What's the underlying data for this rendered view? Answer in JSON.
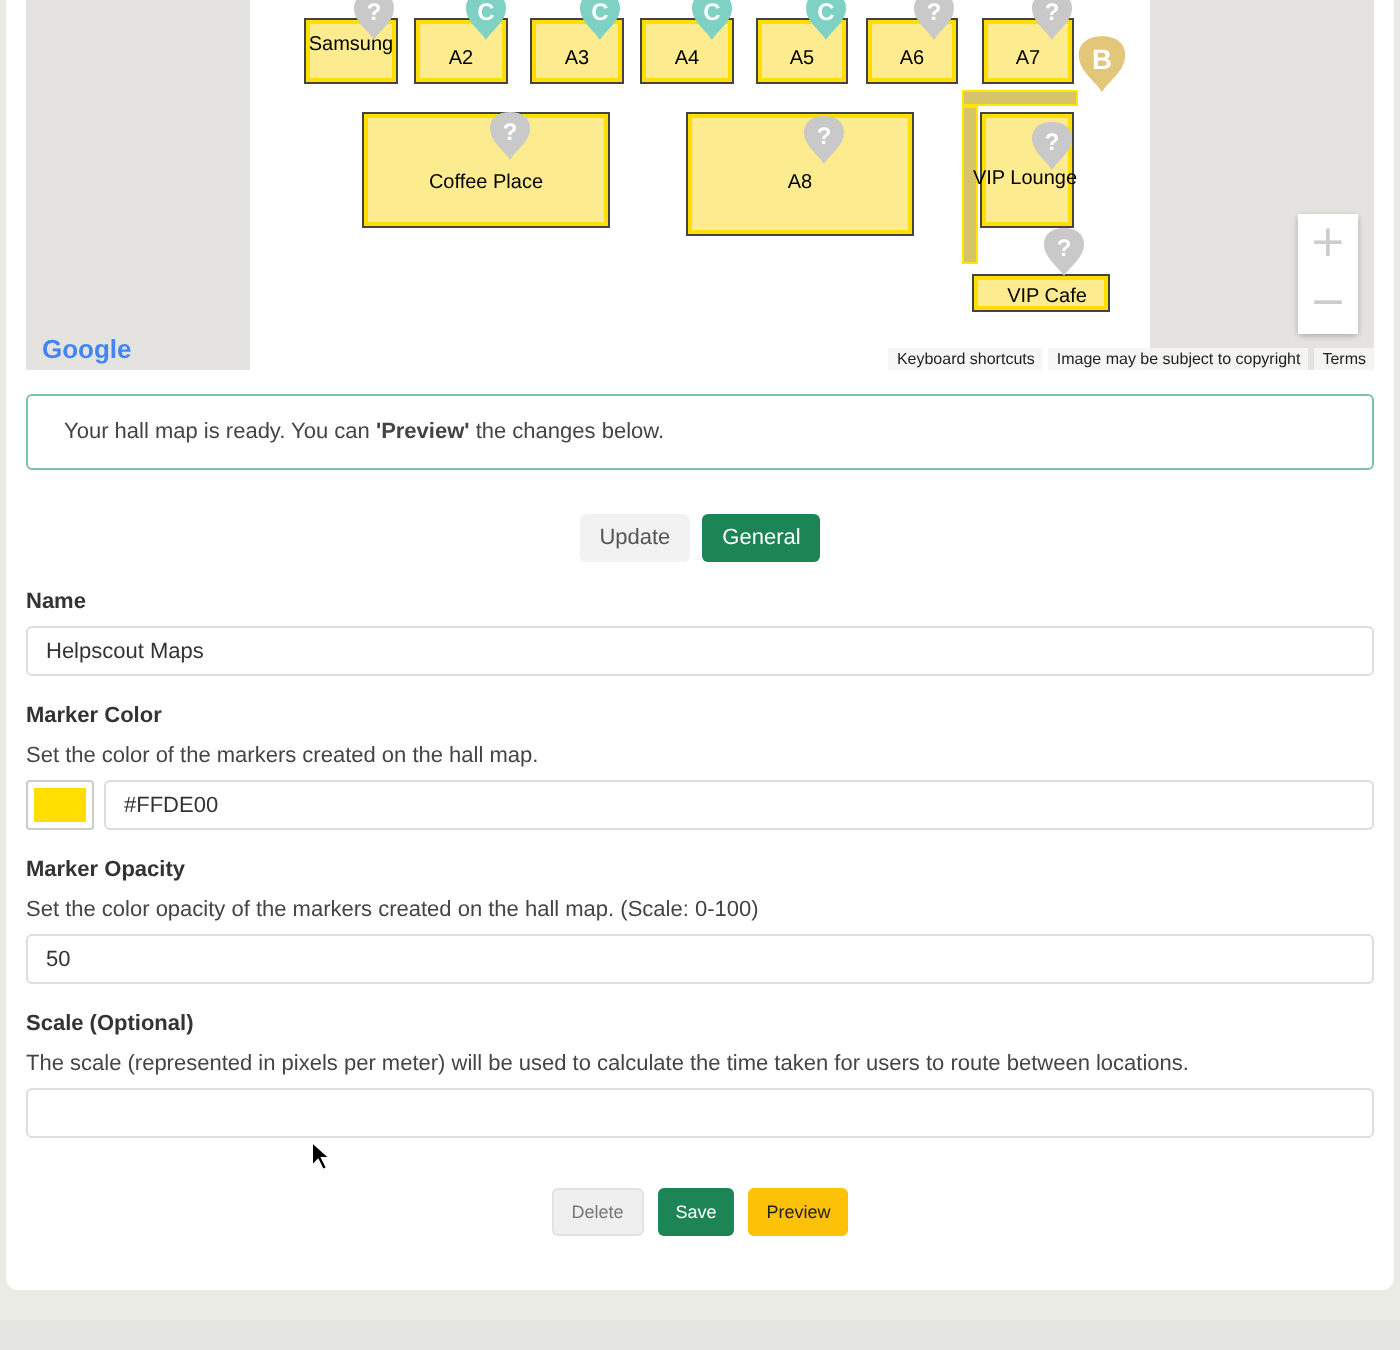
{
  "map": {
    "booths": [
      {
        "label": "Samsung"
      },
      {
        "label": "A2"
      },
      {
        "label": "A3"
      },
      {
        "label": "A4"
      },
      {
        "label": "A5"
      },
      {
        "label": "A6"
      },
      {
        "label": "A7"
      },
      {
        "label": "Coffee Place"
      },
      {
        "label": "A8"
      },
      {
        "label": "VIP Lounge"
      },
      {
        "label": "VIP Cafe"
      }
    ],
    "markers": [
      {
        "letter": "?",
        "color": "#c9c9c9"
      },
      {
        "letter": "C",
        "color": "#7fd1c4"
      },
      {
        "letter": "C",
        "color": "#7fd1c4"
      },
      {
        "letter": "C",
        "color": "#7fd1c4"
      },
      {
        "letter": "C",
        "color": "#7fd1c4"
      },
      {
        "letter": "?",
        "color": "#c9c9c9"
      },
      {
        "letter": "?",
        "color": "#c9c9c9"
      },
      {
        "letter": "B",
        "color": "#e2c77a"
      },
      {
        "letter": "?",
        "color": "#c9c9c9"
      },
      {
        "letter": "?",
        "color": "#c9c9c9"
      },
      {
        "letter": "?",
        "color": "#c9c9c9"
      },
      {
        "letter": "?",
        "color": "#c9c9c9"
      }
    ],
    "zoom_in": "+",
    "zoom_out": "−",
    "logo": "Google",
    "attribution": [
      "Keyboard shortcuts",
      "Image may be subject to copyright",
      "Terms"
    ]
  },
  "notice": "Your hall map is ready. You can **'Preview'** the changes below.",
  "tabs": [
    {
      "label": "Update",
      "selected": false
    },
    {
      "label": "General",
      "selected": true
    }
  ],
  "name": {
    "label": "Name",
    "value": "Helpscout Maps"
  },
  "marker_color": {
    "label": "Marker Color",
    "description": "Set the color of the markers created on the hall map.",
    "value": "#FFDE00"
  },
  "marker_opacity": {
    "label": "Marker Opacity",
    "description": "Set the color opacity of the markers created on the hall map. (Scale: 0-100)",
    "value": "50"
  },
  "scale": {
    "label": "Scale (Optional)",
    "description": "The scale (represented in pixels per meter) will be used to calculate the time taken for users to route between locations."
  },
  "buttons": [
    {
      "label": "Delete",
      "kind": "muted"
    },
    {
      "label": "Save",
      "kind": "primary"
    },
    {
      "label": "Preview",
      "kind": "warning"
    }
  ]
}
